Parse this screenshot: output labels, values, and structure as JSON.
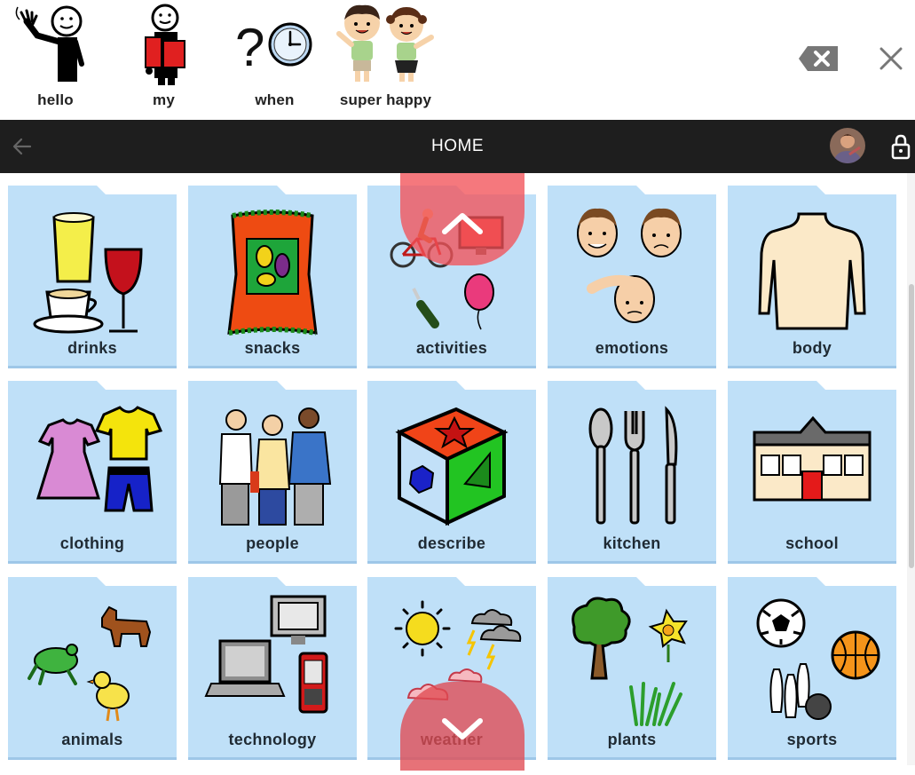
{
  "output": {
    "items": [
      {
        "label": "hello",
        "icon": "waving-person-icon"
      },
      {
        "label": "my",
        "icon": "person-holding-book-icon"
      },
      {
        "label": "when",
        "icon": "question-clock-icon"
      },
      {
        "label": "super happy",
        "icon": "happy-children-icon"
      }
    ]
  },
  "nav": {
    "title": "HOME"
  },
  "grid": {
    "tiles": [
      {
        "label": "drinks",
        "icon": "drinks-icon"
      },
      {
        "label": "snacks",
        "icon": "snacks-icon"
      },
      {
        "label": "activities",
        "icon": "activities-icon"
      },
      {
        "label": "emotions",
        "icon": "emotions-icon"
      },
      {
        "label": "body",
        "icon": "body-icon"
      },
      {
        "label": "clothing",
        "icon": "clothing-icon"
      },
      {
        "label": "people",
        "icon": "people-icon"
      },
      {
        "label": "describe",
        "icon": "describe-icon"
      },
      {
        "label": "kitchen",
        "icon": "kitchen-icon"
      },
      {
        "label": "school",
        "icon": "school-icon"
      },
      {
        "label": "animals",
        "icon": "animals-icon"
      },
      {
        "label": "technology",
        "icon": "technology-icon"
      },
      {
        "label": "weather",
        "icon": "weather-icon"
      },
      {
        "label": "plants",
        "icon": "plants-icon"
      },
      {
        "label": "sports",
        "icon": "sports-icon"
      }
    ]
  },
  "colors": {
    "tile_bg": "#bfe0f8",
    "navbar_bg": "#1e1e1e",
    "scroll_overlay": "#f25258"
  }
}
